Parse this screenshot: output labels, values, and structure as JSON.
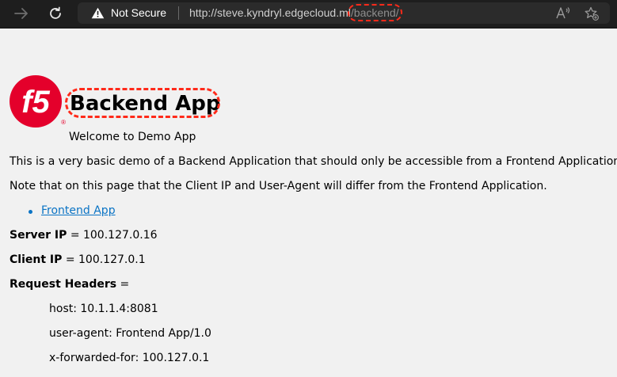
{
  "browser": {
    "security_label": "Not Secure",
    "url_base": "http://steve.kyndryl.edgecloud.ml",
    "url_path": "/backend/"
  },
  "page": {
    "title": "Backend App",
    "welcome": "Welcome to Demo App",
    "description": "This is a very basic demo of a Backend Application that should only be accessible from a Frontend Application.",
    "note": "Note that on this page that the Client IP and User-Agent will differ from the Frontend Application.",
    "links": [
      {
        "label": "Frontend App"
      }
    ],
    "server_ip_label": "Server IP",
    "server_ip": "= 100.127.0.16",
    "client_ip_label": "Client IP",
    "client_ip": "= 100.127.0.1",
    "request_headers_label": "Request Headers",
    "request_headers_suffix": "=",
    "headers": [
      "host: 10.1.1.4:8081",
      "user-agent: Frontend App/1.0",
      "x-forwarded-for: 100.127.0.1"
    ]
  },
  "logo": {
    "text": "f5",
    "mark": "®",
    "color": "#e4002b"
  },
  "colors": {
    "annotation": "#ff2a1a",
    "link": "#0b74c5",
    "page_bg": "#f1f1f1",
    "toolbar_bg": "#1e1e1e"
  }
}
